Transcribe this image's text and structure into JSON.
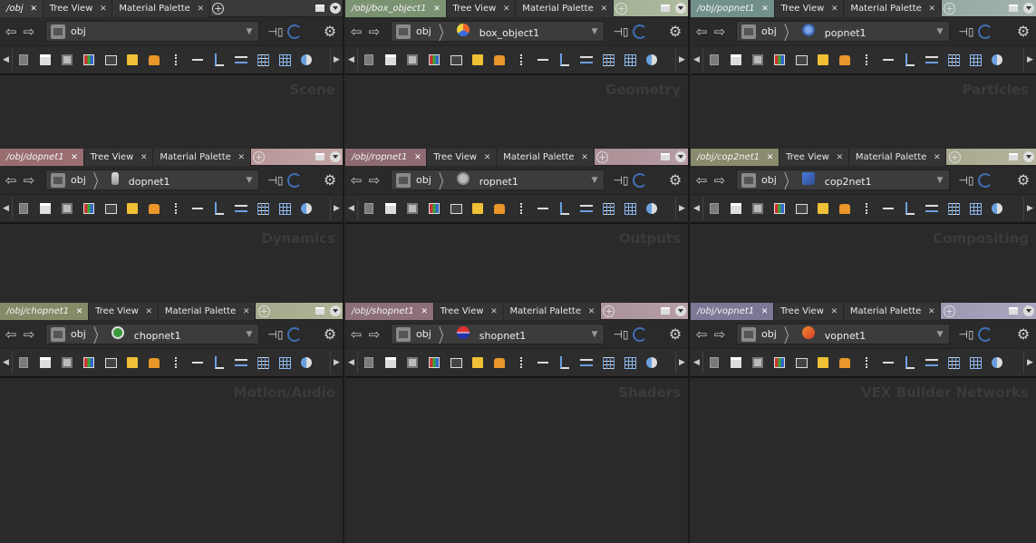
{
  "tabs": {
    "tree_view": "Tree View",
    "material_palette": "Material Palette"
  },
  "path_root": "obj",
  "colors": {
    "accent_blue": "#3f6fb3",
    "sticky_yellow": "#f0c036",
    "box_orange": "#e9962a"
  },
  "panes": [
    {
      "path_tab": "/obj",
      "tab_color": "#3a3a3a",
      "bar_gradient": "linear-gradient(90deg,#3a3a3a,#3a3a3a)",
      "node": "",
      "node_icon": "",
      "label": "Scene"
    },
    {
      "path_tab": "/obj/box_object1",
      "tab_color": "#7b9273",
      "bar_gradient": "linear-gradient(90deg,#6f8a66,#aebba0)",
      "node": "box_object1",
      "node_icon": "box",
      "label": "Geometry"
    },
    {
      "path_tab": "/obj/popnet1",
      "tab_color": "#72908a",
      "bar_gradient": "linear-gradient(90deg,#6c8b86,#a4b4ae)",
      "node": "popnet1",
      "node_icon": "pop",
      "label": "Particles"
    },
    {
      "path_tab": "/obj/dopnet1",
      "tab_color": "#9a6e70",
      "bar_gradient": "linear-gradient(90deg,#96696b,#c4a6a7)",
      "node": "dopnet1",
      "node_icon": "dop",
      "label": "Dynamics"
    },
    {
      "path_tab": "/obj/ropnet1",
      "tab_color": "#8e6a72",
      "bar_gradient": "linear-gradient(90deg,#8c6871,#b69da3)",
      "node": "ropnet1",
      "node_icon": "rop",
      "label": "Outputs"
    },
    {
      "path_tab": "/obj/cop2net1",
      "tab_color": "#8a8a6e",
      "bar_gradient": "linear-gradient(90deg,#86866a,#b5b59d)",
      "node": "cop2net1",
      "node_icon": "cop",
      "label": "Compositing"
    },
    {
      "path_tab": "/obj/chopnet1",
      "tab_color": "#868a68",
      "bar_gradient": "linear-gradient(90deg,#828766,#b2b497)",
      "node": "chopnet1",
      "node_icon": "chop",
      "label": "Motion/Audio"
    },
    {
      "path_tab": "/obj/shopnet1",
      "tab_color": "#8c6f7a",
      "bar_gradient": "linear-gradient(90deg,#8a6c77,#b69fa7)",
      "node": "shopnet1",
      "node_icon": "shop",
      "label": "Shaders"
    },
    {
      "path_tab": "/obj/vopnet1",
      "tab_color": "#7c7896",
      "bar_gradient": "linear-gradient(90deg,#7a7593,#aaa6bf)",
      "node": "vopnet1",
      "node_icon": "vop",
      "label": "VEX Builder Networks"
    }
  ]
}
